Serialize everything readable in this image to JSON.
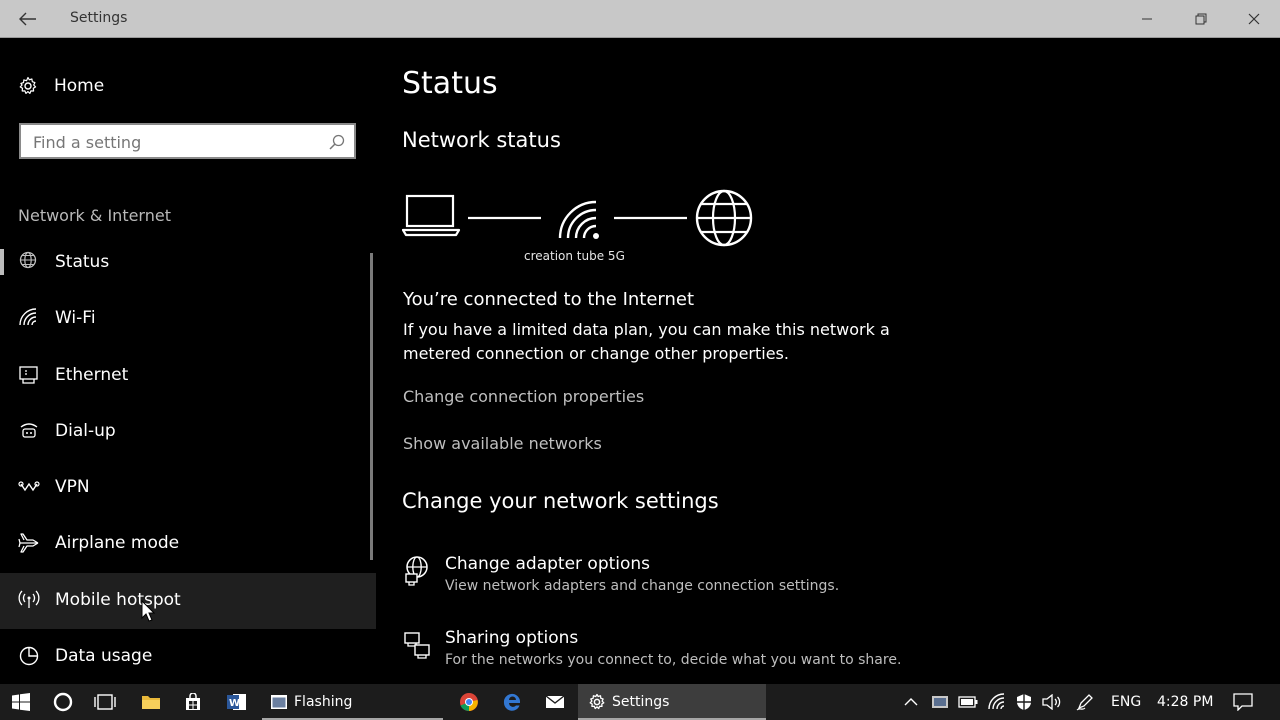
{
  "window": {
    "title": "Settings"
  },
  "sidebar": {
    "home_label": "Home",
    "search_placeholder": "Find a setting",
    "section_label": "Network & Internet",
    "items": [
      {
        "label": "Status",
        "icon": "globe-status-icon"
      },
      {
        "label": "Wi-Fi",
        "icon": "wifi-icon"
      },
      {
        "label": "Ethernet",
        "icon": "ethernet-icon"
      },
      {
        "label": "Dial-up",
        "icon": "dialup-icon"
      },
      {
        "label": "VPN",
        "icon": "vpn-icon"
      },
      {
        "label": "Airplane mode",
        "icon": "airplane-icon"
      },
      {
        "label": "Mobile hotspot",
        "icon": "hotspot-icon"
      },
      {
        "label": "Data usage",
        "icon": "data-usage-icon"
      }
    ],
    "selected": "Status",
    "hovered": "Mobile hotspot"
  },
  "main": {
    "title": "Status",
    "network_status_heading": "Network status",
    "network_name": "creation tube 5G",
    "connected_heading": "You’re connected to the Internet",
    "connected_desc": "If you have a limited data plan, you can make this network a metered connection or change other properties.",
    "link_change_props": "Change connection properties",
    "link_show_networks": "Show available networks",
    "change_heading": "Change your network settings",
    "options": [
      {
        "title": "Change adapter options",
        "desc": "View network adapters and change connection settings.",
        "icon": "adapter-icon"
      },
      {
        "title": "Sharing options",
        "desc": "For the networks you connect to, decide what you want to share.",
        "icon": "sharing-icon"
      }
    ]
  },
  "taskbar": {
    "apps": [
      {
        "label": "Flashing",
        "state": "open"
      },
      {
        "label": "Settings",
        "state": "active"
      }
    ],
    "language": "ENG",
    "time": "4:28 PM"
  },
  "colors": {
    "background": "#000000",
    "titlebar": "#c8c8c8",
    "taskbar": "#1c1c1c",
    "link": "#bfbfbf",
    "hover": "#1f1f1f"
  }
}
